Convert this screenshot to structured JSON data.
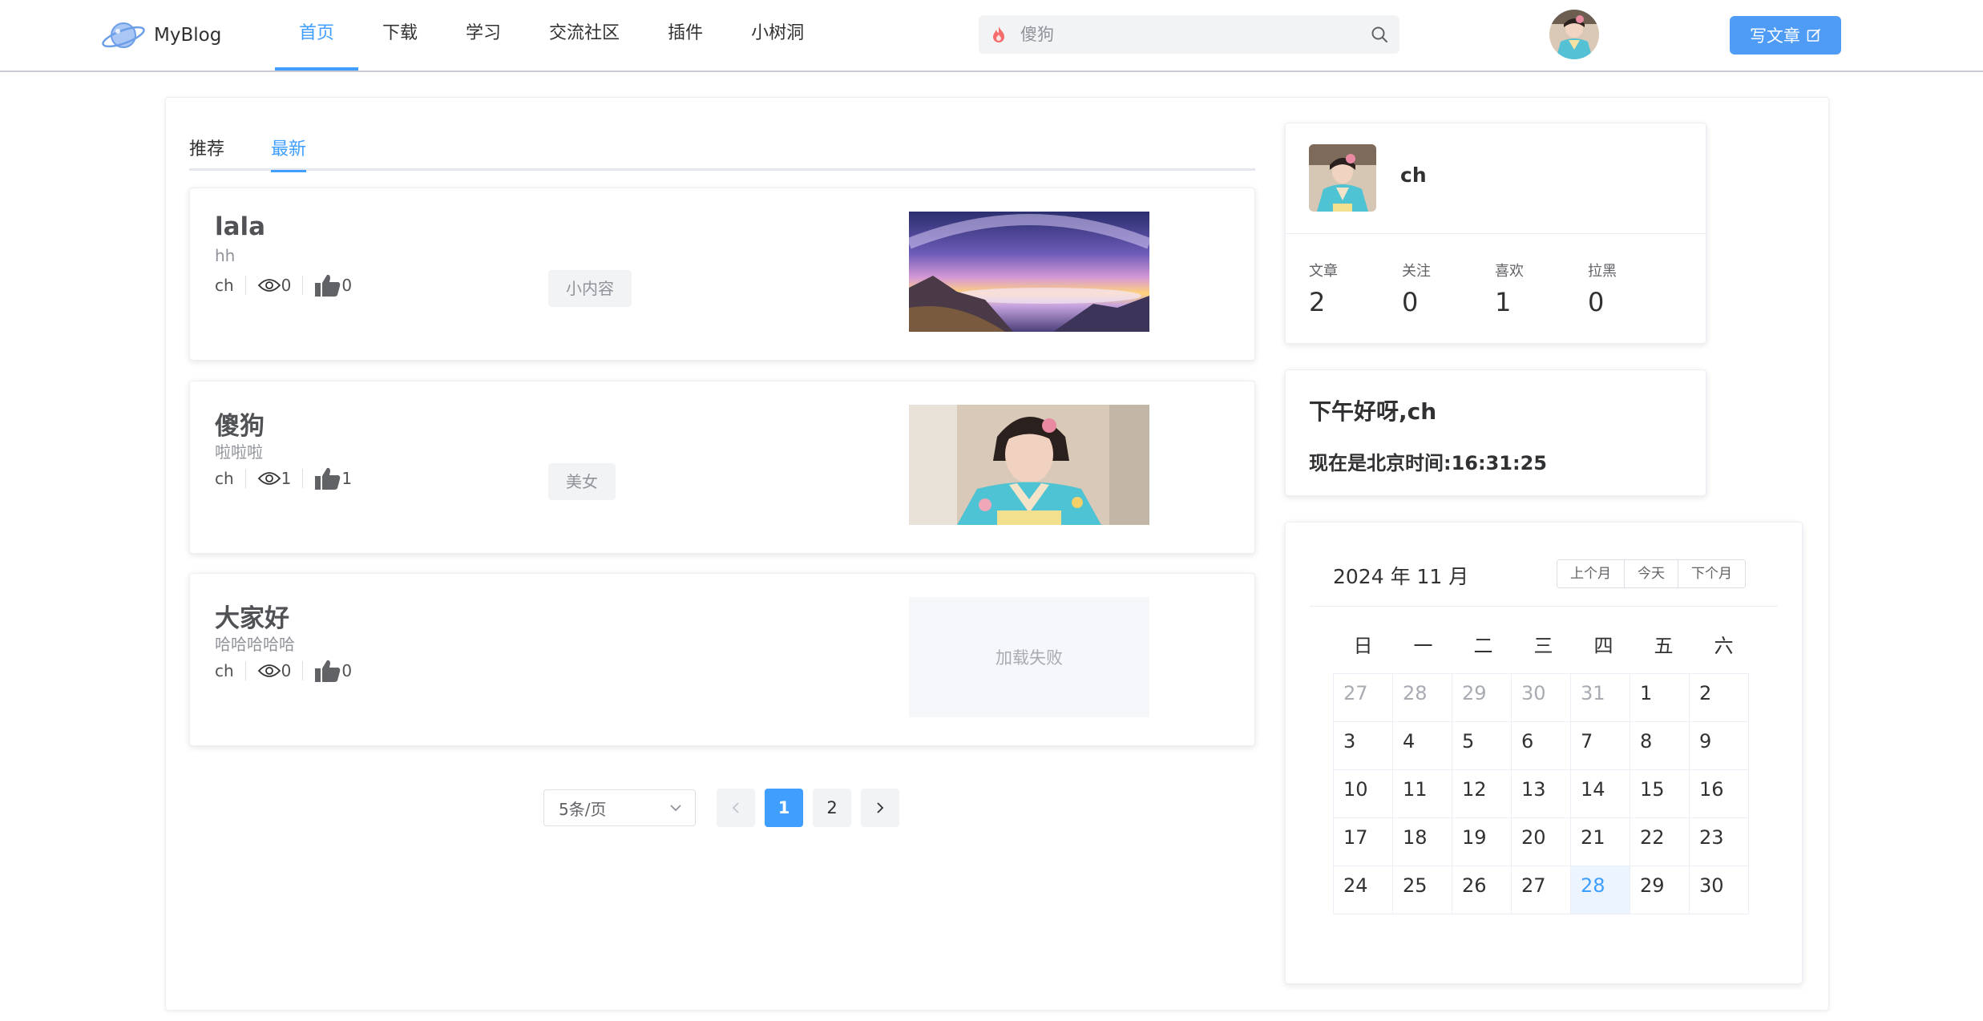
{
  "brand": {
    "name": "MyBlog"
  },
  "nav": {
    "items": [
      "首页",
      "下载",
      "学习",
      "交流社区",
      "插件",
      "小树洞"
    ],
    "active": 0
  },
  "search": {
    "value": "",
    "placeholder": "傻狗"
  },
  "header": {
    "write_label": "写文章"
  },
  "tabs": {
    "items": [
      "推荐",
      "最新"
    ],
    "active": 1
  },
  "articles": [
    {
      "title": "lala",
      "summary": "hh",
      "author": "ch",
      "views": "0",
      "likes": "0",
      "tag": "小内容",
      "image": "night-sky-landscape"
    },
    {
      "title": "傻狗",
      "summary": "啦啦啦",
      "author": "ch",
      "views": "1",
      "likes": "1",
      "tag": "美女",
      "image": "kimono-portrait"
    },
    {
      "title": "大家好",
      "summary": "哈哈哈哈哈",
      "author": "ch",
      "views": "0",
      "likes": "0",
      "tag": "",
      "image_status": "加载失败"
    }
  ],
  "pagination": {
    "page_size_label": "5条/页",
    "pages": [
      "1",
      "2"
    ],
    "current": "1",
    "prev_icon": "chevron-left-icon",
    "next_icon": "chevron-right-icon"
  },
  "profile": {
    "name": "ch",
    "stats": [
      {
        "label": "文章",
        "value": "2"
      },
      {
        "label": "关注",
        "value": "0"
      },
      {
        "label": "喜欢",
        "value": "1"
      },
      {
        "label": "拉黑",
        "value": "0"
      }
    ]
  },
  "greeting": {
    "line1": "下午好呀,ch",
    "line2": "现在是北京时间:16:31:25"
  },
  "calendar": {
    "title": "2024 年 11 月",
    "buttons": [
      "上个月",
      "今天",
      "下个月"
    ],
    "weekdays": [
      "日",
      "一",
      "二",
      "三",
      "四",
      "五",
      "六"
    ],
    "prev_month_days": [
      "27",
      "28",
      "29",
      "30",
      "31"
    ],
    "days": [
      "1",
      "2",
      "3",
      "4",
      "5",
      "6",
      "7",
      "8",
      "9",
      "10",
      "11",
      "12",
      "13",
      "14",
      "15",
      "16",
      "17",
      "18",
      "19",
      "20",
      "21",
      "22",
      "23",
      "24",
      "25",
      "26",
      "27",
      "28",
      "29",
      "30"
    ],
    "today": "28"
  },
  "colors": {
    "accent": "#409eff",
    "write_button": "#4f9cf6",
    "flame": "#f56c6c"
  }
}
